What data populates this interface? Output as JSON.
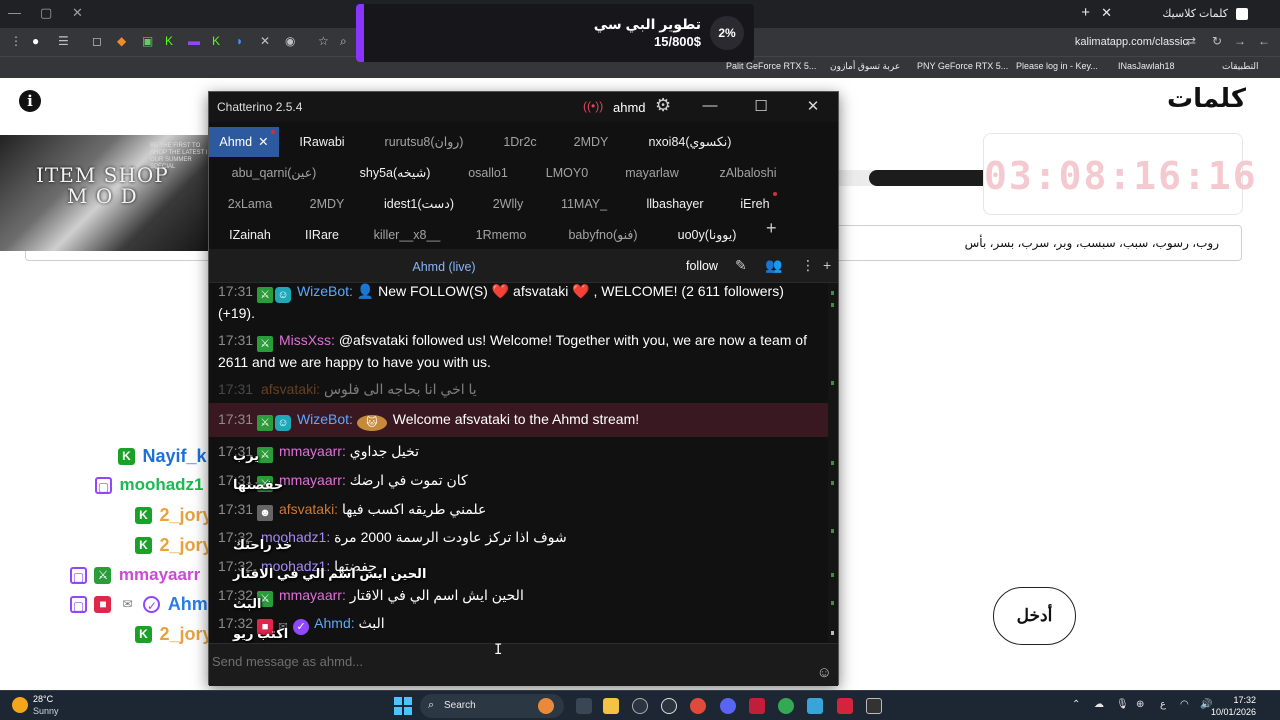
{
  "browser": {
    "tab_title": "كلمات كلاسيك",
    "url": "kalimatapp.com/classic",
    "bookmarks": [
      {
        "label": "Palit GeForce RTX 5..."
      },
      {
        "label": "عربة تسوق أمازون"
      },
      {
        "label": "PNY GeForce RTX 5..."
      },
      {
        "label": "Please log in - Key..."
      },
      {
        "label": "INasJawlah18"
      },
      {
        "label": "التطبيقات"
      }
    ]
  },
  "page": {
    "logo": "كلمات",
    "timer": "03:08:16:16",
    "progress_fraction": 0.92,
    "words": "روب، رسوب، سبب، سبسب، وبر، سرب، بسر، بأس",
    "enter_button": "أدخل",
    "overlay_title": "ITEM SHOP\nM O D",
    "overlay_small_text": "BE THE FIRST TO SHOP THE LATEST IN OUR SUMMER SPECIAL",
    "overlay_chat": [
      {
        "name": "Nayif_k",
        "color": "#1e6fd9",
        "badge": "K",
        "msg": "يرب"
      },
      {
        "name": "moohadz1",
        "color": "#1db954",
        "badge": "twitch",
        "msg": "حفضتها"
      },
      {
        "name": "2_jory",
        "color": "#e8a33d",
        "badge": "K",
        "msg": ""
      },
      {
        "name": "2_jory",
        "color": "#e8a33d",
        "badge": "K",
        "msg": "خذ راحتك"
      },
      {
        "name": "mmayaarr",
        "color": "#c94bd6",
        "badge": "twitch",
        "msg": "الحين ايش اسم الي في الاقتار"
      },
      {
        "name": "Ahmd",
        "color": "#2b7de9",
        "badge": "twitch",
        "msg": "البث"
      },
      {
        "name": "2_jory",
        "color": "#e8a33d",
        "badge": "K",
        "msg": "اكتب ريو"
      }
    ]
  },
  "donation": {
    "title": "تطوير البي سي",
    "amount": "15/800$",
    "percent": "2%"
  },
  "chatterino": {
    "title": "Chatterino 2.5.4",
    "user": "ahmd",
    "tabs_row1": [
      "Ahmd",
      "IRawabi",
      "rurutsu8(روان)",
      "1Dr2c",
      "2MDY",
      "nxoi84(نكسوي)"
    ],
    "tabs_row2": [
      "abu_qarni(عين)",
      "shy5a(شيخه)",
      "osallo1",
      "LMOY0",
      "mayarlaw",
      "zAlbaloshi"
    ],
    "tabs_row3": [
      "2xLama",
      "2MDY",
      "idest1(دست)",
      "2Wlly",
      "11MAY_",
      "llbashayer",
      "iEreh"
    ],
    "tabs_row4": [
      "IZainah",
      "IIRare",
      "killer__x8__",
      "1Rmemo",
      "babyfno(فنو)",
      "uo0y(يوونا)"
    ],
    "split_title": "Ahmd (live)",
    "follow_label": "follow",
    "input_placeholder": "Send message as ahmd...",
    "messages": [
      {
        "time": "17:31",
        "user": "WizeBot:",
        "color": "#5ca8ff",
        "text": "👤 New FOLLOW(S) ❤️ afsvataki ❤️ , WELCOME! (2 611 followers) (+19)."
      },
      {
        "time": "17:31",
        "user": "MissXss:",
        "color": "#e070d8",
        "text": "@afsvataki followed us! Welcome! Together with you, we are now a team of 2611 and we are happy to have you with us."
      },
      {
        "time": "17:31",
        "user": "afsvataki:",
        "color": "#c97a3a",
        "text": "يا اخي انا بحاجه الى فلوس"
      },
      {
        "time": "17:31",
        "user": "WizeBot:",
        "color": "#5ca8ff",
        "text": "Welcome afsvataki to the Ahmd stream!"
      },
      {
        "time": "17:31",
        "user": "mmayaarr:",
        "color": "#e070d8",
        "text": "تخيل جداوي"
      },
      {
        "time": "17:31",
        "user": "mmayaarr:",
        "color": "#e070d8",
        "text": "كان تموت في ارضك"
      },
      {
        "time": "17:31",
        "user": "afsvataki:",
        "color": "#c97a3a",
        "text": "علمني طريقه اكسب فيها"
      },
      {
        "time": "17:32",
        "user": "moohadz1:",
        "color": "#a78bfa",
        "text": "شوف اذا تركز عاودت الرسمة 2000 مرة"
      },
      {
        "time": "17:32",
        "user": "moohadz1:",
        "color": "#a78bfa",
        "text": "حفضتها"
      },
      {
        "time": "17:32",
        "user": "mmayaarr:",
        "color": "#e070d8",
        "text": "الحين ايش اسم الي في الاقتار"
      },
      {
        "time": "17:32",
        "user": "Ahmd:",
        "color": "#5ca8ff",
        "text": "البث"
      }
    ]
  },
  "taskbar": {
    "temp": "28°C",
    "weather": "Sunny",
    "search": "Search",
    "time": "17:32",
    "date": "10/01/2026"
  }
}
